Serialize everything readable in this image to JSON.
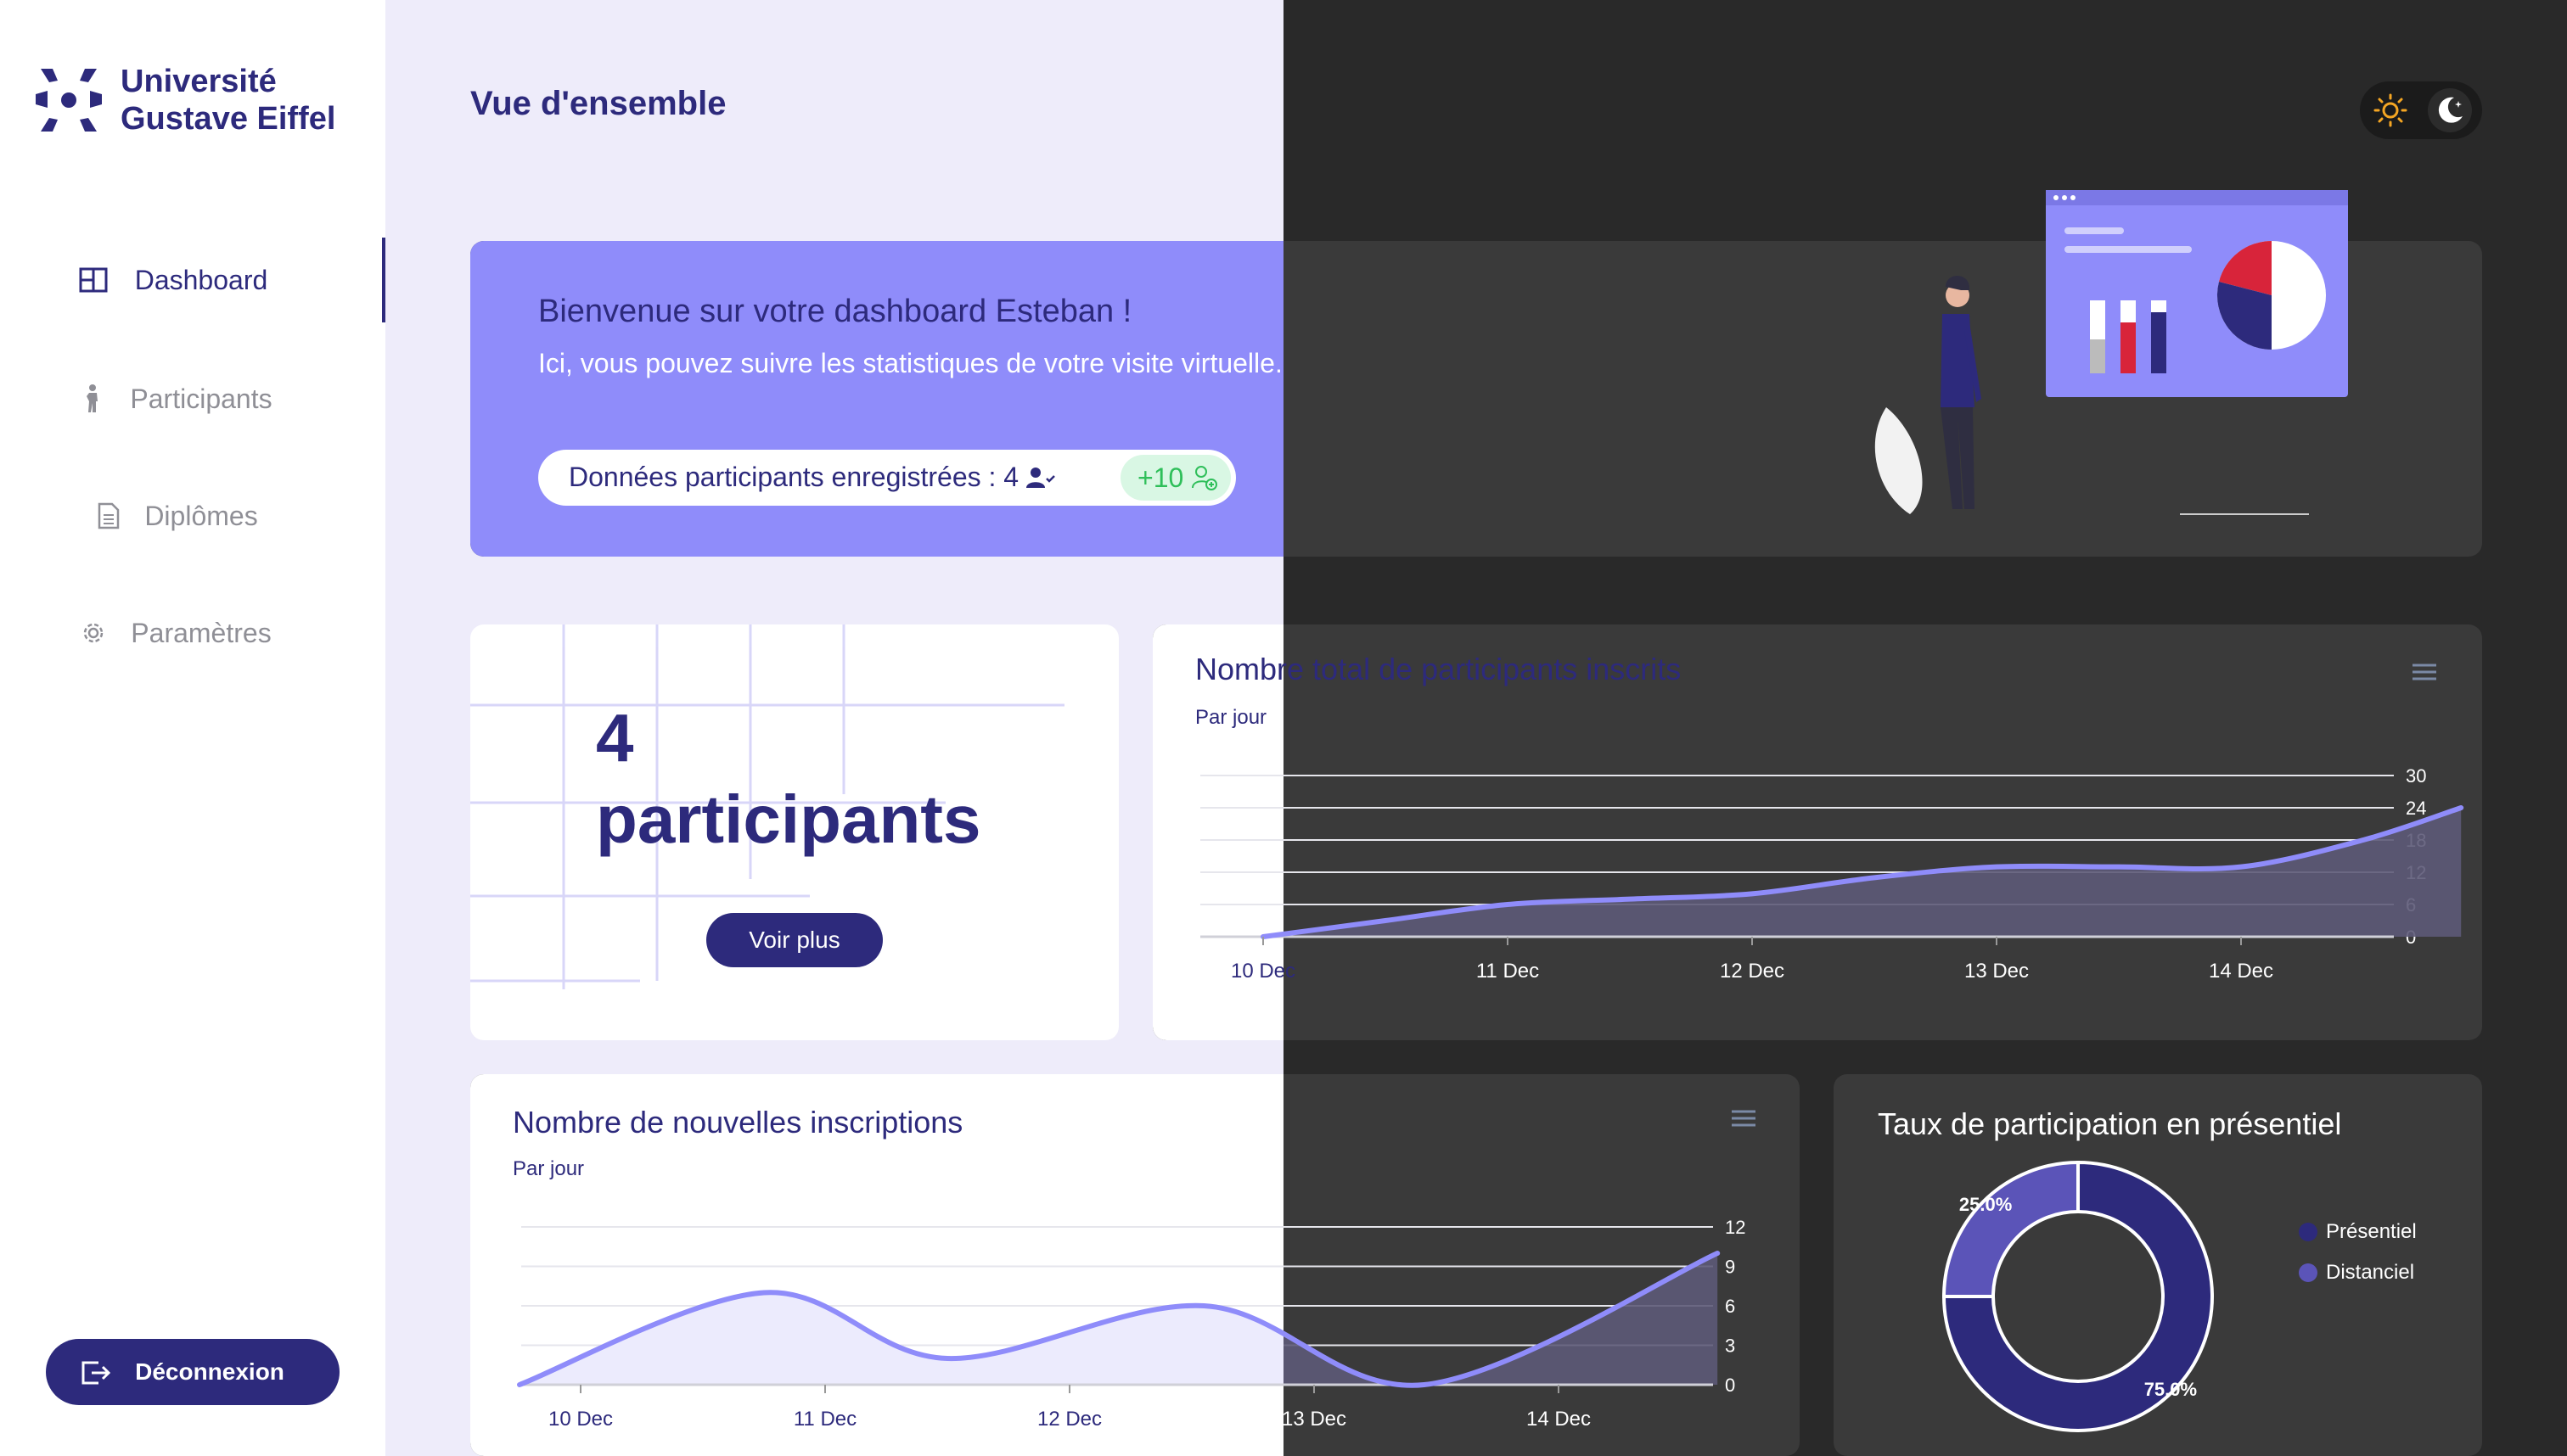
{
  "brand": {
    "line1": "Université",
    "line2": "Gustave Eiffel",
    "color": "#2d2a7c"
  },
  "sidebar": {
    "items": [
      {
        "label": "Dashboard",
        "icon": "dashboard-icon",
        "active": true
      },
      {
        "label": "Participants",
        "icon": "person-icon",
        "active": false
      },
      {
        "label": "Diplômes",
        "icon": "document-icon",
        "active": false
      },
      {
        "label": "Paramètres",
        "icon": "gear-icon",
        "active": false
      }
    ],
    "logout_label": "Déconnexion"
  },
  "header": {
    "title": "Vue d'ensemble",
    "theme_toggle": [
      "sun-icon",
      "moon-icon"
    ]
  },
  "welcome": {
    "title": "Bienvenue sur votre dashboard Esteban !",
    "subtitle": "Ici, vous pouvez suivre les statistiques de votre visite virtuelle.",
    "stats_text": "Données participants enregistrées : 4",
    "badge": "+10"
  },
  "participants_card": {
    "count": "4",
    "label": "participants",
    "button": "Voir plus"
  },
  "charts": {
    "total": {
      "title": "Nombre total de participants inscrits",
      "subtitle": "Par jour"
    },
    "new": {
      "title": "Nombre de nouvelles inscriptions",
      "subtitle": "Par jour"
    },
    "rate": {
      "title": "Taux de participation en présentiel"
    }
  },
  "chart_data": [
    {
      "type": "area",
      "title": "Nombre total de participants inscrits",
      "subtitle": "Par jour",
      "x": [
        "10 Dec",
        "11 Dec",
        "12 Dec",
        "13 Dec",
        "14 Dec"
      ],
      "x_values": [
        0,
        0.5,
        1,
        1.5,
        2,
        2.5,
        3,
        3.5,
        4,
        4.5,
        4.9
      ],
      "y_values": [
        0,
        3,
        6,
        7,
        8,
        11,
        13,
        13,
        13,
        18,
        24
      ],
      "yticks": [
        0,
        6,
        12,
        18,
        24,
        30
      ],
      "ylim": [
        0,
        30
      ],
      "color": "#8f8cfa"
    },
    {
      "type": "area",
      "title": "Nombre de nouvelles inscriptions",
      "subtitle": "Par jour",
      "x": [
        "10 Dec",
        "11 Dec",
        "12 Dec",
        "13 Dec",
        "14 Dec"
      ],
      "x_values": [
        -0.25,
        0.75,
        1.5,
        2.55,
        3.45,
        4.65
      ],
      "y_values": [
        0,
        7,
        2,
        6,
        0,
        10
      ],
      "yticks": [
        0,
        3,
        6,
        9,
        12
      ],
      "ylim": [
        0,
        12
      ],
      "color": "#8f8cfa"
    },
    {
      "type": "pie",
      "title": "Taux de participation en présentiel",
      "labels": [
        "Présentiel",
        "Distanciel"
      ],
      "values": [
        75,
        25
      ],
      "value_labels": [
        "75.0%",
        "25.0%"
      ],
      "colors": [
        "#2d2a7c",
        "#5b54b8"
      ]
    }
  ]
}
